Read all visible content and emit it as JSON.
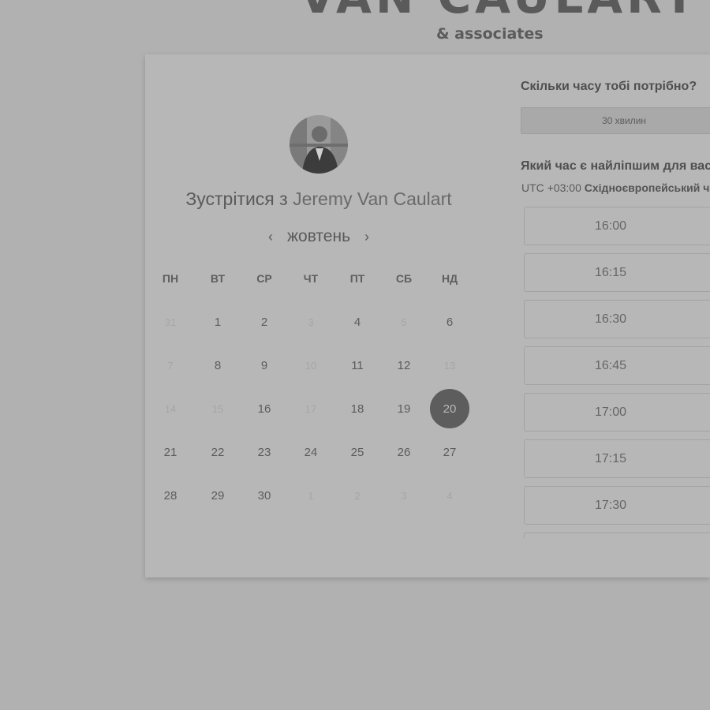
{
  "brand": {
    "title": "VAN CAULART",
    "subtitle": "& associates"
  },
  "meeting": {
    "prefix": "Зустрітися з",
    "host": "Jeremy Van Caulart"
  },
  "calendar": {
    "prev_icon": "‹",
    "next_icon": "›",
    "month": "жовтень",
    "weekdays": [
      "ПН",
      "ВТ",
      "СР",
      "ЧТ",
      "ПТ",
      "СБ",
      "НД"
    ],
    "selected": "20",
    "weeks": [
      [
        {
          "d": "31",
          "dim": true
        },
        {
          "d": "1"
        },
        {
          "d": "2"
        },
        {
          "d": "3",
          "dim": true
        },
        {
          "d": "4"
        },
        {
          "d": "5",
          "dim": true
        },
        {
          "d": "6"
        }
      ],
      [
        {
          "d": "7",
          "dim": true
        },
        {
          "d": "8"
        },
        {
          "d": "9"
        },
        {
          "d": "10",
          "dim": true
        },
        {
          "d": "11"
        },
        {
          "d": "12"
        },
        {
          "d": "13",
          "dim": true
        }
      ],
      [
        {
          "d": "14",
          "dim": true
        },
        {
          "d": "15",
          "dim": true
        },
        {
          "d": "16"
        },
        {
          "d": "17",
          "dim": true
        },
        {
          "d": "18"
        },
        {
          "d": "19"
        },
        {
          "d": "20",
          "sel": true
        }
      ],
      [
        {
          "d": "21"
        },
        {
          "d": "22"
        },
        {
          "d": "23"
        },
        {
          "d": "24"
        },
        {
          "d": "25"
        },
        {
          "d": "26"
        },
        {
          "d": "27"
        }
      ],
      [
        {
          "d": "28"
        },
        {
          "d": "29"
        },
        {
          "d": "30"
        },
        {
          "d": "1",
          "dim": true
        },
        {
          "d": "2",
          "dim": true
        },
        {
          "d": "3",
          "dim": true
        },
        {
          "d": "4",
          "dim": true
        }
      ]
    ]
  },
  "duration": {
    "question": "Скільки часу тобі потрібно?",
    "value": "30 хвилин"
  },
  "time": {
    "question": "Який час є найліпшим для вас?",
    "tz_offset": "UTC +03:00",
    "tz_name": "Східноєвропейський час",
    "slots": [
      "16:00",
      "16:15",
      "16:30",
      "16:45",
      "17:00",
      "17:15",
      "17:30",
      ""
    ]
  }
}
